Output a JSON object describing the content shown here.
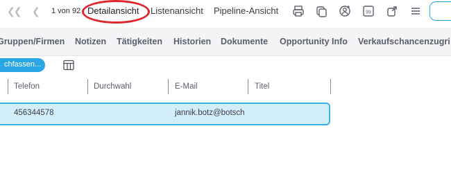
{
  "toolbar": {
    "first_icon": "double-chevron-left-icon",
    "prev_icon": "chevron-left-icon",
    "pager_text": "1 von 92",
    "views": [
      {
        "label": "Detailansicht",
        "active": true
      },
      {
        "label": "Listenansicht",
        "active": false
      },
      {
        "label": "Pipeline-Ansicht",
        "active": false
      }
    ],
    "icons": [
      "printer-icon",
      "copy-icon",
      "user-add-icon",
      "quote-99-icon",
      "share-icon",
      "menu-icon"
    ],
    "highlight_color": "#e0262d"
  },
  "tabs": [
    {
      "label": "Gruppen/Firmen"
    },
    {
      "label": "Notizen"
    },
    {
      "label": "Tätigkeiten"
    },
    {
      "label": "Historien"
    },
    {
      "label": "Dokumente"
    },
    {
      "label": "Opportunity Info"
    },
    {
      "label": "Verkaufschancenzugri"
    }
  ],
  "actions": {
    "primary_label": "chfassen...",
    "table_icon": "table-columns-icon",
    "accent": "#2ba6e4"
  },
  "table": {
    "columns": [
      "Telefon",
      "Durchwahl",
      "E-Mail",
      "Titel"
    ],
    "rows": [
      {
        "telefon": "456344578",
        "durchwahl": "",
        "email": "jannik.botz@botsch",
        "titel": ""
      }
    ],
    "row_highlight": "#d3eefb"
  }
}
